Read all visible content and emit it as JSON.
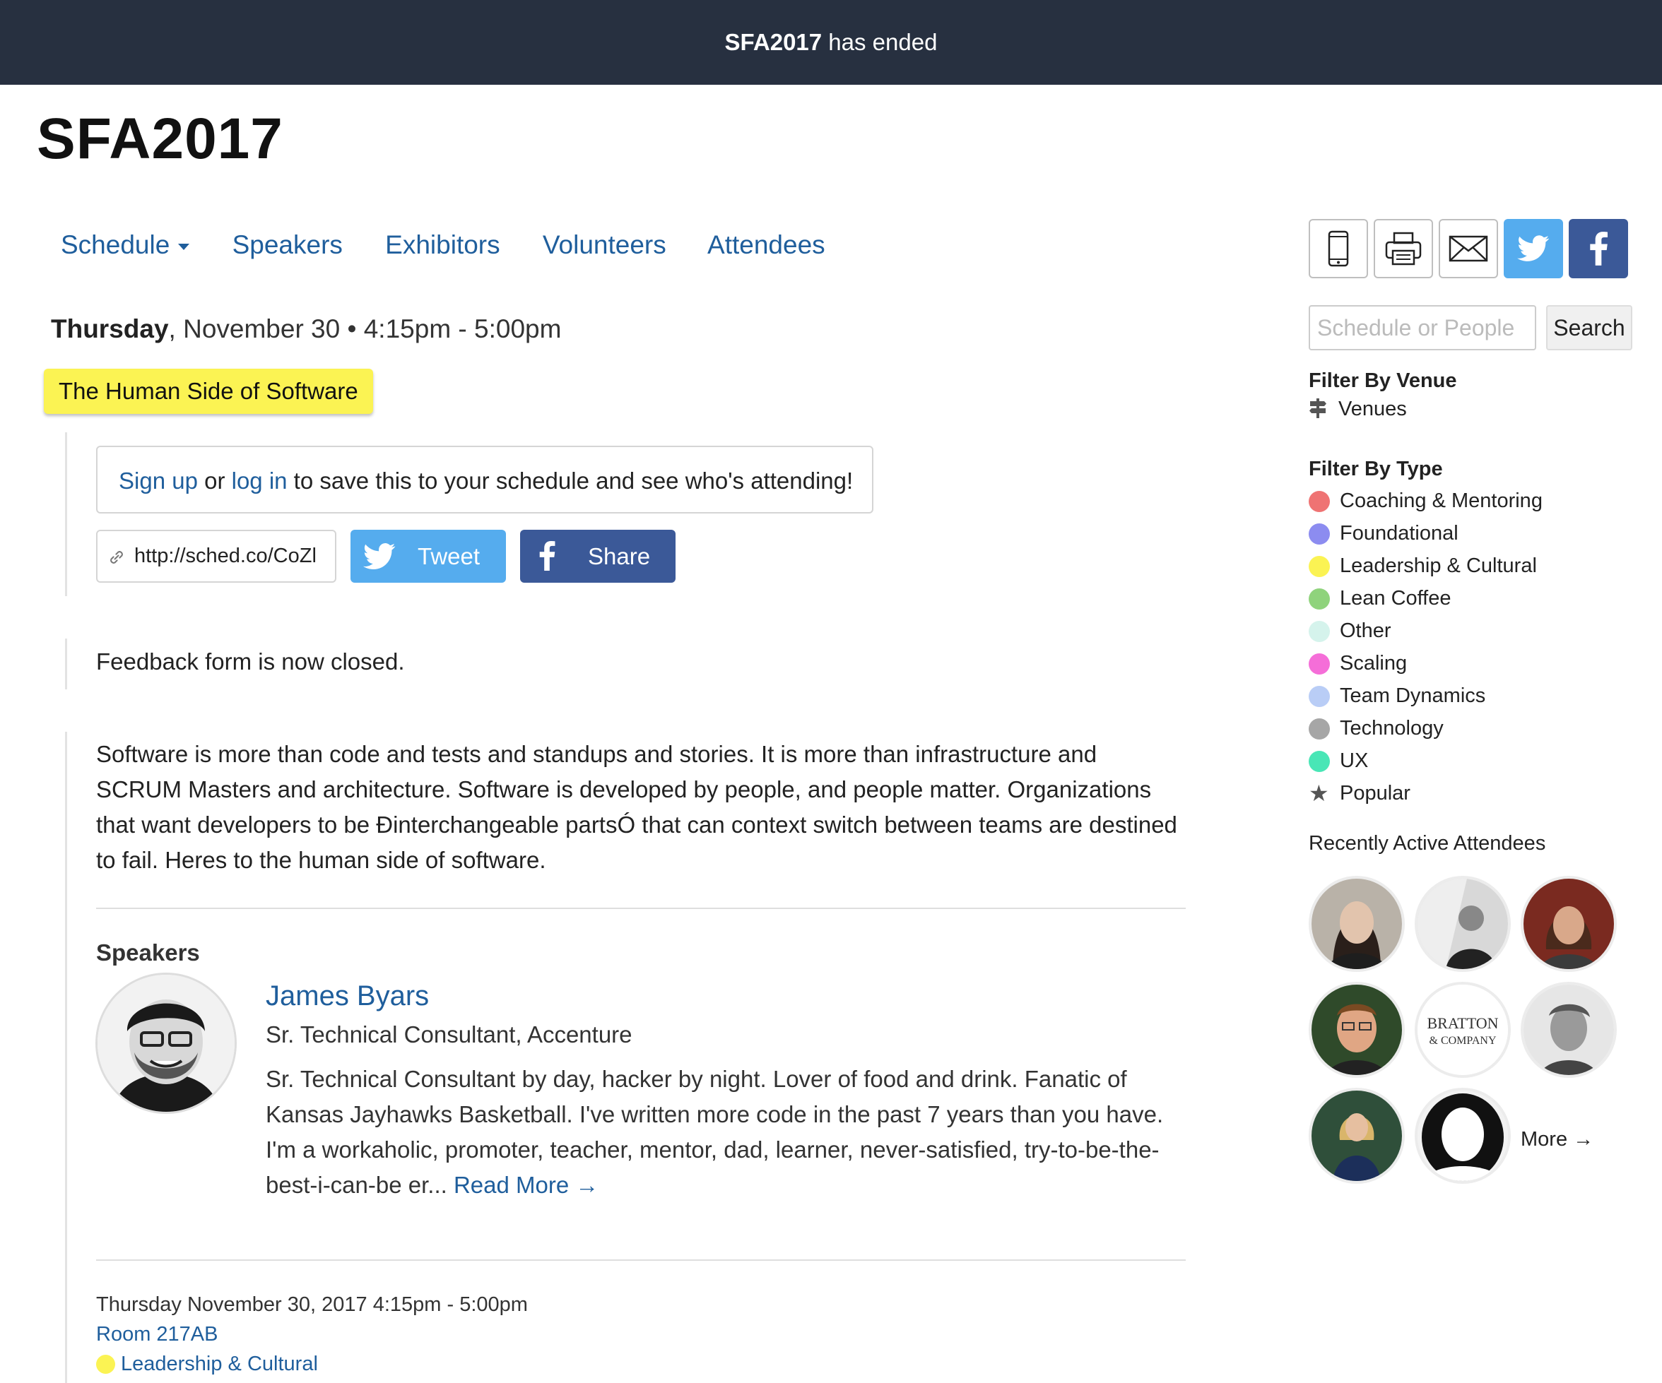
{
  "banner": {
    "event": "SFA2017",
    "suffix": " has ended"
  },
  "site_title": "SFA2017",
  "nav": {
    "schedule": "Schedule",
    "speakers": "Speakers",
    "exhibitors": "Exhibitors",
    "volunteers": "Volunteers",
    "attendees": "Attendees"
  },
  "session": {
    "day": "Thursday",
    "datetime_rest": ", November 30 • 4:15pm - 5:00pm",
    "title": "The Human Side of Software",
    "signup": {
      "link1": "Sign up",
      "mid": " or ",
      "link2": "log in",
      "rest": " to save this to your schedule and see who's attending!"
    },
    "short_url": "http://sched.co/CoZl",
    "tweet_label": "Tweet",
    "share_label": "Share",
    "feedback": "Feedback form is now closed.",
    "description": "Software is more than code and tests and standups and stories. It is more than infrastructure and SCRUM Masters and architecture. Software is developed by people, and people matter. Organizations that want developers to be Ðinterchangeable partsÓ that can context switch between teams are destined to fail. Heres to the human side of software."
  },
  "speakers": {
    "heading": "Speakers",
    "items": [
      {
        "name": "James Byars",
        "role": "Sr. Technical Consultant, Accenture",
        "bio": "Sr. Technical Consultant by day, hacker by night. Lover of food and drink. Fanatic of Kansas Jayhawks Basketball. I've written more code in the past 7 years than you have. I'm a workaholic, promoter, teacher, mentor, dad, learner, never-satisfied, try-to-be-the-best-i-can-be er... ",
        "read_more": "Read More →"
      }
    ]
  },
  "meta": {
    "datetime": "Thursday November 30, 2017 4:15pm - 5:00pm",
    "room": "Room 217AB",
    "type": "Leadership & Cultural"
  },
  "sidebar": {
    "search_placeholder": "Schedule or People",
    "search_button": "Search",
    "filter_venue_heading": "Filter By Venue",
    "venues_label": "Venues",
    "filter_type_heading": "Filter By Type",
    "types": [
      {
        "label": "Coaching & Mentoring",
        "color": "#ef7373"
      },
      {
        "label": "Foundational",
        "color": "#8c8cf0"
      },
      {
        "label": "Leadership & Cultural",
        "color": "#fbf353"
      },
      {
        "label": "Lean Coffee",
        "color": "#8fd37c"
      },
      {
        "label": "Other",
        "color": "#d5f3ec"
      },
      {
        "label": "Scaling",
        "color": "#f56ed8"
      },
      {
        "label": "Team Dynamics",
        "color": "#b9cdf6"
      },
      {
        "label": "Technology",
        "color": "#a6a6a6"
      },
      {
        "label": "UX",
        "color": "#49e6b6"
      }
    ],
    "popular_label": "Popular",
    "recent_heading": "Recently Active Attendees",
    "company_logo_text": {
      "line1": "BRATTON",
      "line2": "& COMPANY"
    },
    "more_label": "More →"
  }
}
